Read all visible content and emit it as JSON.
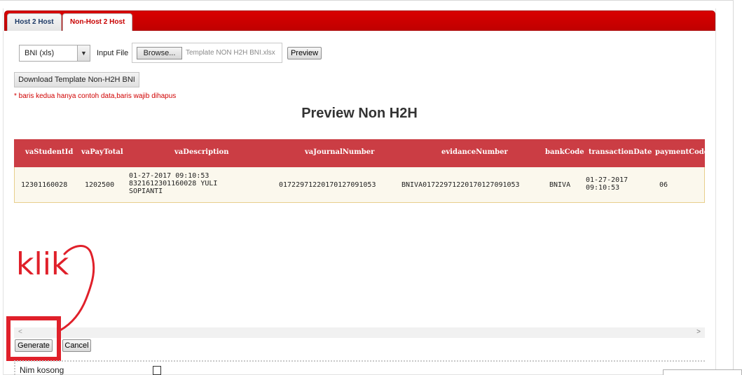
{
  "tabs": [
    {
      "label": "Host 2 Host",
      "active": false
    },
    {
      "label": "Non-Host 2 Host",
      "active": true
    }
  ],
  "form": {
    "bank_select": "BNI (xls)",
    "input_file_label": "Input File",
    "browse_label": "Browse...",
    "file_name": "Template NON H2H BNI.xlsx",
    "preview_label": "Preview",
    "download_label": "Download Template Non-H2H BNI",
    "note": "* baris kedua hanya contoh data,baris wajib dihapus"
  },
  "preview": {
    "title": "Preview Non H2H",
    "columns": [
      "vaStudentId",
      "vaPayTotal",
      "vaDescription",
      "vaJournalNumber",
      "evidanceNumber",
      "bankCode",
      "transactionDate",
      "paymentCode"
    ],
    "row": {
      "vaStudentId": "12301160028",
      "vaPayTotal": "1202500",
      "vaDescription": [
        "01-27-2017 09:10:53",
        "8321612301160028 YULI",
        "SOPIANTI"
      ],
      "vaJournalNumber": "0172297122017012709105​3",
      "evidanceNumber": "BNIVA0172297122017012709105​3",
      "bankCode": "BNIVA",
      "transactionDate": [
        "01-27-2017",
        "09:10:53"
      ],
      "paymentCode": "06"
    }
  },
  "actions": {
    "generate_label": "Generate",
    "cancel_label": "Cancel"
  },
  "annotation": {
    "text": "klik",
    "color": "#e0202a"
  },
  "options": {
    "nim_kosong_label": "Nim kosong",
    "nim_kosong_checked": false
  },
  "colors": {
    "tab_red": "#cc0000",
    "table_header": "#cb3d44",
    "table_row_bg": "#fbf8ed",
    "note_red": "#d00000"
  },
  "scrollbar": {
    "left_icon": "chevron-left-icon",
    "right_icon": "chevron-right-icon"
  }
}
